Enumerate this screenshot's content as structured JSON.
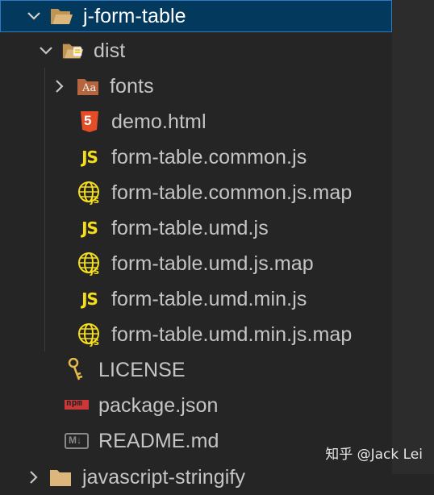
{
  "explorer": {
    "root": {
      "label": "j-form-table"
    },
    "dist": {
      "label": "dist"
    },
    "items": [
      {
        "label": "fonts",
        "icon": "font-folder-icon"
      },
      {
        "label": "demo.html",
        "icon": "html5-icon"
      },
      {
        "label": "form-table.common.js",
        "icon": "js-icon"
      },
      {
        "label": "form-table.common.js.map",
        "icon": "js-map-icon"
      },
      {
        "label": "form-table.umd.js",
        "icon": "js-icon"
      },
      {
        "label": "form-table.umd.js.map",
        "icon": "js-map-icon"
      },
      {
        "label": "form-table.umd.min.js",
        "icon": "js-icon"
      },
      {
        "label": "form-table.umd.min.js.map",
        "icon": "js-map-icon"
      }
    ],
    "root_files": [
      {
        "label": "LICENSE",
        "icon": "key-icon"
      },
      {
        "label": "package.json",
        "icon": "npm-icon"
      },
      {
        "label": "README.md",
        "icon": "markdown-icon"
      }
    ],
    "next_folder": {
      "label": "javascript-stringify"
    },
    "js_glyph": "JS",
    "html_glyph": "5",
    "font_glyph": "Aa",
    "npm_glyph": "npm",
    "md_glyph": "M↓"
  },
  "watermark": "知乎 @Jack Lei",
  "colors": {
    "selection": "#04395e",
    "selection_border": "#2f78c5",
    "js_yellow": "#f5de19",
    "html_orange": "#e44d26",
    "background": "#252526"
  }
}
